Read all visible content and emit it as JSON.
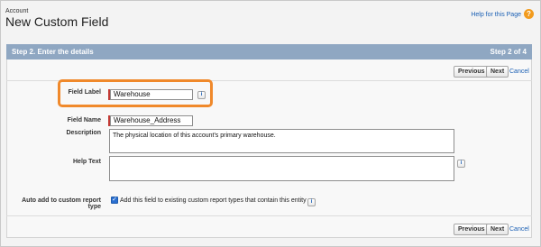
{
  "header": {
    "breadcrumb": "Account",
    "title": "New Custom Field",
    "help_link": "Help for this Page",
    "help_icon": "?"
  },
  "step": {
    "title": "Step 2. Enter the details",
    "counter": "Step 2 of 4"
  },
  "buttons": {
    "previous": "Previous",
    "next": "Next",
    "cancel": "Cancel"
  },
  "form": {
    "field_label": {
      "label": "Field Label",
      "value": "Warehouse"
    },
    "field_name": {
      "label": "Field Name",
      "value": "Warehouse_Address"
    },
    "description": {
      "label": "Description",
      "value": "The physical location of this account's primary warehouse."
    },
    "help_text": {
      "label": "Help Text",
      "value": ""
    },
    "auto_add": {
      "label": "Auto add to custom report type",
      "checked": true,
      "text": "Add this field to existing custom report types that contain this entity"
    },
    "info_glyph": "i"
  },
  "colors": {
    "header_bar": "#8fa7c2",
    "highlight": "#f0892b",
    "required": "#c23934",
    "link": "#1a5fb4"
  }
}
